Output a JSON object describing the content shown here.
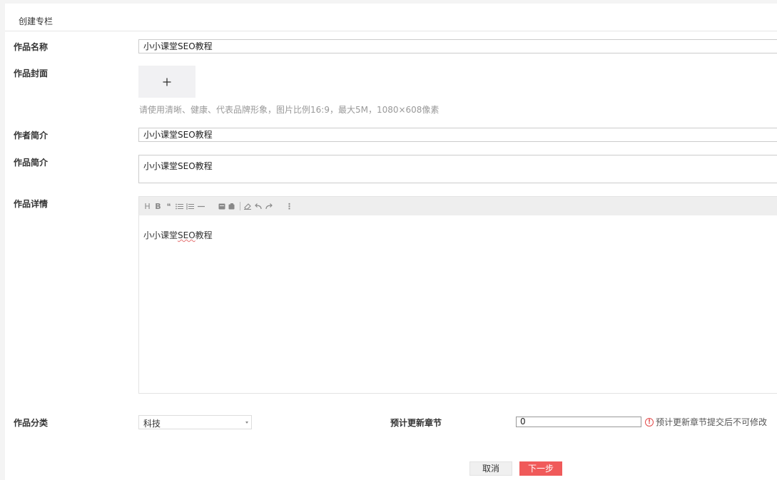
{
  "page": {
    "title": "创建专栏"
  },
  "form": {
    "work_name": {
      "label": "作品名称",
      "value": "小小课堂SEO教程"
    },
    "cover": {
      "label": "作品封面",
      "upload_symbol": "+",
      "hint": "请使用清晰、健康、代表品牌形象，图片比例16:9，最大5M，1080×608像素"
    },
    "author_intro": {
      "label": "作者简介",
      "value": "小小课堂SEO教程"
    },
    "work_intro": {
      "label": "作品简介",
      "value": "小小课堂SEO教程"
    },
    "details": {
      "label": "作品详情",
      "body_prefix": "小小课堂",
      "body_marked": "SEO",
      "body_suffix": "教程",
      "toolbar": {
        "heading": "H",
        "bold": "B",
        "quote": "❝",
        "more": "⋮"
      }
    },
    "category": {
      "label": "作品分类",
      "value": "科技"
    },
    "chapters": {
      "label": "预计更新章节",
      "value": "0",
      "warning": "预计更新章节提交后不可修改",
      "warning_icon": "!"
    }
  },
  "actions": {
    "cancel": "取消",
    "next": "下一步"
  },
  "colors": {
    "primary": "#f05a5a",
    "warning": "#e24a4a"
  }
}
